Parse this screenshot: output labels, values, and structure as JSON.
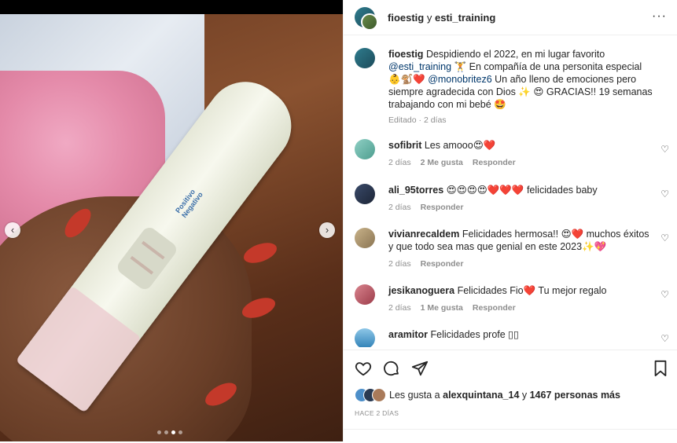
{
  "post": {
    "authors": {
      "main": "fioestig",
      "joiner": "y",
      "collab": "esti_training"
    },
    "more_label": "···",
    "caption": {
      "user": "fioestig",
      "text_1": "Despidiendo el 2022, en mi lugar favorito",
      "mention_1": "@esti_training",
      "text_2": "🏋 En compañía de una personita especial 👶🐒❤️",
      "mention_2": "@monobritez6",
      "text_3": "Un año lleno de emociones pero siempre agradecida con Dios ✨ 😍 GRACIAS!! 19 semanas trabajando con mi bebé 🤩",
      "meta": "Editado · 2 días"
    },
    "test_label": "Positivo Negativo"
  },
  "comments": [
    {
      "user": "sofibrit",
      "text": "Les amooo😍❤️",
      "time": "2 días",
      "likes": "2 Me gusta",
      "reply": "Responder"
    },
    {
      "user": "ali_95torres",
      "text": "😍😍😍😍❤️❤️❤️ felicidades baby",
      "time": "2 días",
      "likes": "",
      "reply": "Responder"
    },
    {
      "user": "vivianrecaldem",
      "text": "Felicidades hermosa!! 😍❤️ muchos éxitos y que todo sea mas que genial en este 2023✨💖",
      "time": "2 días",
      "likes": "",
      "reply": "Responder"
    },
    {
      "user": "jesikanoguera",
      "text": "Felicidades Fio❤️ Tu mejor regalo",
      "time": "2 días",
      "likes": "1 Me gusta",
      "reply": "Responder"
    },
    {
      "user": "aramitor",
      "text": "Felicidades profe ▯▯",
      "time": "",
      "likes": "",
      "reply": ""
    }
  ],
  "likes_line": {
    "prefix": "Les gusta a",
    "user": "alexquintana_14",
    "joiner": "y",
    "count": "1467 personas más"
  },
  "posted_when": "HACE 2 DÍAS",
  "nav": {
    "prev": "‹",
    "next": "›"
  },
  "heart_glyph": "♡",
  "colors": {
    "link": "#00376b",
    "meta": "#8e8e8e",
    "text": "#262626"
  }
}
